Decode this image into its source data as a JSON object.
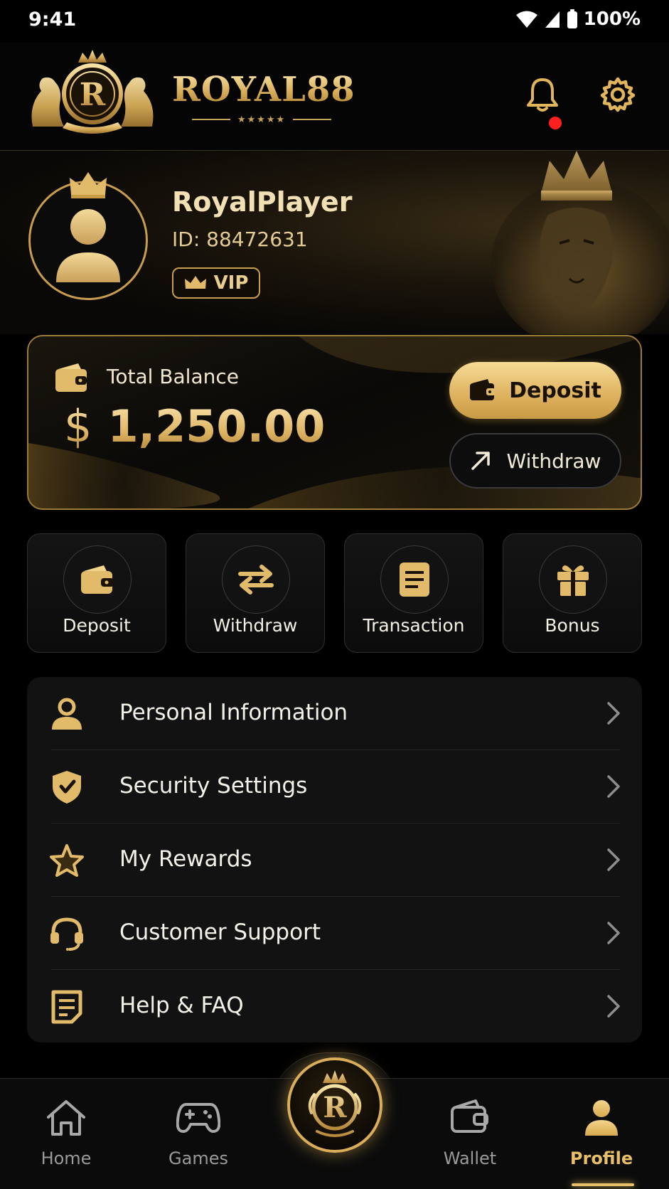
{
  "status_bar": {
    "time": "9:41",
    "battery": "100%"
  },
  "header": {
    "brand": "ROYAL88",
    "brand_stars": "★★★★★",
    "logo_letter": "R",
    "notification_count_dot": true
  },
  "profile": {
    "username": "RoyalPlayer",
    "id_text": "ID: 88472631",
    "vip_label": "VIP"
  },
  "balance": {
    "label": "Total Balance",
    "currency": "$",
    "amount": "1,250.00",
    "deposit_label": "Deposit",
    "withdraw_label": "Withdraw"
  },
  "quick_actions": [
    {
      "label": "Deposit",
      "icon": "wallet-icon"
    },
    {
      "label": "Withdraw",
      "icon": "swap-arrows-icon"
    },
    {
      "label": "Transaction",
      "icon": "document-list-icon"
    },
    {
      "label": "Bonus",
      "icon": "gift-icon"
    }
  ],
  "menu": [
    {
      "label": "Personal Information",
      "icon": "user-icon"
    },
    {
      "label": "Security Settings",
      "icon": "shield-icon"
    },
    {
      "label": "My Rewards",
      "icon": "star-icon"
    },
    {
      "label": "Customer Support",
      "icon": "headset-icon"
    },
    {
      "label": "Help & FAQ",
      "icon": "faq-document-icon"
    }
  ],
  "bottom_nav": {
    "items": [
      {
        "label": "Home",
        "icon": "home-icon"
      },
      {
        "label": "Games",
        "icon": "gamepad-icon"
      },
      {
        "label": "Wallet",
        "icon": "wallet-icon"
      },
      {
        "label": "Profile",
        "icon": "user-icon",
        "active": true
      }
    ],
    "center_letter": "R"
  },
  "colors": {
    "gold": "#e7bf66",
    "gold_dark": "#c89d4f",
    "background": "#000000",
    "notification": "#ff1f1f"
  }
}
